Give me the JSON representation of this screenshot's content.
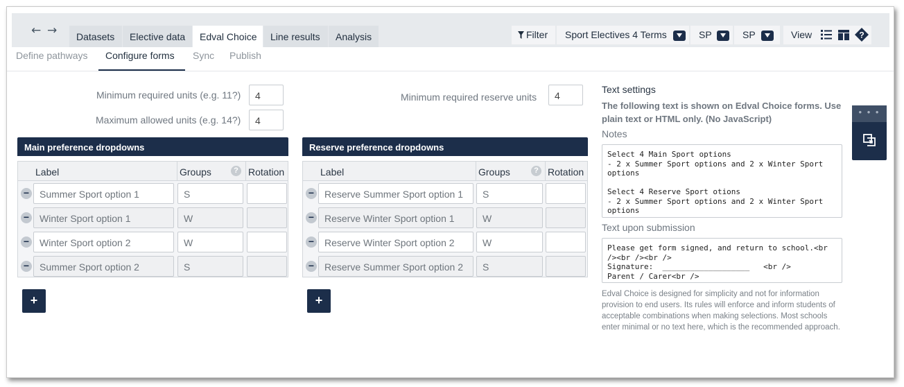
{
  "nav": {
    "back": "←",
    "forward": "→",
    "tabs": [
      "Datasets",
      "Elective data",
      "Edval Choice",
      "Line results",
      "Analysis"
    ],
    "filter_label": "Filter",
    "dataset_select": "Sport Electives 4 Terms",
    "select_2": "SP",
    "select_3": "SP",
    "view_label": "View"
  },
  "subnav": [
    "Define pathways",
    "Configure forms",
    "Sync",
    "Publish"
  ],
  "units": {
    "min_label": "Minimum required units (e.g. 11?)",
    "min_value": "4",
    "max_label": "Maximum allowed units (e.g. 14?)",
    "max_value": "4",
    "reserve_label": "Minimum required reserve units",
    "reserve_value": "4"
  },
  "main_panel": {
    "title": "Main preference dropdowns",
    "columns": [
      "Label",
      "Groups",
      "Rotation"
    ],
    "rows": [
      {
        "label": "Summer Sport option 1",
        "group": "S"
      },
      {
        "label": "Winter Sport option 1",
        "group": "W"
      },
      {
        "label": "Winter Sport option 2",
        "group": "W"
      },
      {
        "label": "Summer Sport option 2",
        "group": "S"
      }
    ],
    "add": "+"
  },
  "reserve_panel": {
    "title": "Reserve preference dropdowns",
    "columns": [
      "Label",
      "Groups",
      "Rotation"
    ],
    "rows": [
      {
        "label": "Reserve Summer Sport option 1",
        "group": "S"
      },
      {
        "label": "Reserve Winter Sport option 1",
        "group": "W"
      },
      {
        "label": "Reserve Winter Sport option 2",
        "group": "W"
      },
      {
        "label": "Reserve  Summer Sport option 2",
        "group": "S"
      }
    ],
    "add": "+"
  },
  "text_settings": {
    "title": "Text settings",
    "description": "The following text is shown on Edval Choice forms. Use plain text or HTML only. (No JavaScript)",
    "notes_label": "Notes",
    "notes_value": "Select 4 Main Sport options\n- 2 x Summer Sport options and 2 x Winter Sport options\n\nSelect 4 Reserve Sport otions\n- 2 x Summer Sport options and 2 x Winter Sport options",
    "submission_label": "Text upon submission",
    "submission_value": "Please get form signed, and return to school.<br /><br /><br />\nSignature:  ___________________   <br />\nParent / Carer<br />",
    "footnote": "Edval Choice is designed for simplicity and not for information provision to end users. Its rules will enforce and inform students of acceptable combinations when making selections. Most schools enter minimal or no text here, which is the recommended approach."
  },
  "side_panel": {
    "dots": "• • •"
  },
  "icons": [
    "arrow-left-icon",
    "arrow-right-icon",
    "filter-icon",
    "list-icon",
    "table-icon",
    "help-icon",
    "minus-icon",
    "copy-icon"
  ]
}
